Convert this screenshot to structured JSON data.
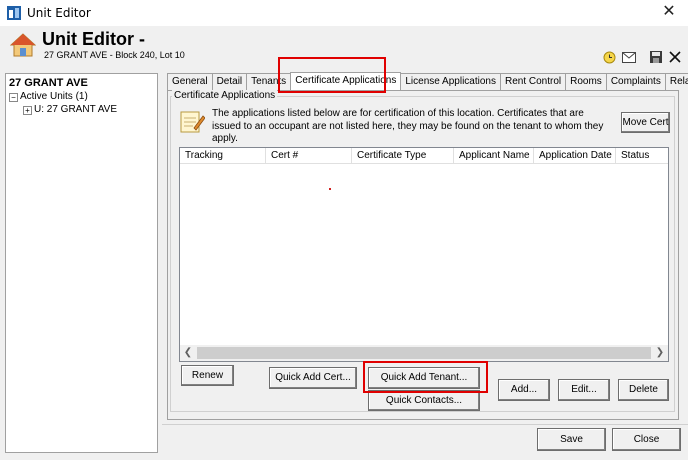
{
  "window": {
    "title": "Unit Editor",
    "close_glyph": "✕"
  },
  "header": {
    "title": "Unit Editor -",
    "subtitle": "27 GRANT AVE - Block 240, Lot 10"
  },
  "toolbar_icons": [
    "clock-icon",
    "mail-icon",
    "save-disk-icon",
    "close-x-icon"
  ],
  "tree": {
    "root": "27 GRANT AVE",
    "items": [
      {
        "label": "Active Units (1)",
        "expander": "⊟"
      },
      {
        "label": "U: 27 GRANT AVE",
        "expander": "⊞"
      }
    ]
  },
  "tabs": [
    {
      "label": "General"
    },
    {
      "label": "Detail"
    },
    {
      "label": "Tenants"
    },
    {
      "label": "Certificate Applications",
      "active": true
    },
    {
      "label": "License Applications"
    },
    {
      "label": "Rent Control"
    },
    {
      "label": "Rooms"
    },
    {
      "label": "Complaints"
    },
    {
      "label": "Related"
    }
  ],
  "panel": {
    "group_label": "Certificate Applications",
    "info_text": "The applications listed below are for certification of this location. Certificates that are issued to an occupant are not listed here, they may be found on the tenant to whom they apply.",
    "move_cert": "Move Cert"
  },
  "grid": {
    "columns": [
      "Tracking",
      "Cert #",
      "Certificate Type",
      "Applicant Name",
      "Application Date",
      "Status"
    ],
    "rows": []
  },
  "buttons": {
    "renew": "Renew",
    "quick_add_cert": "Quick Add Cert...",
    "quick_add_tenant": "Quick Add Tenant...",
    "quick_contacts": "Quick Contacts...",
    "add": "Add...",
    "edit": "Edit...",
    "delete": "Delete",
    "save": "Save",
    "close": "Close"
  },
  "colors": {
    "highlight": "#e00000",
    "window_bg": "#f0f0f0"
  }
}
